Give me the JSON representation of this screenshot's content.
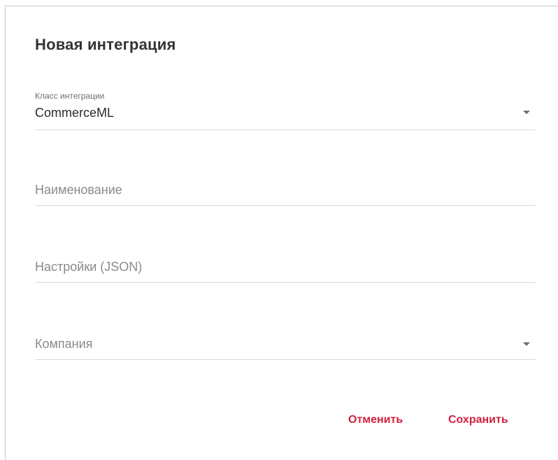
{
  "dialog": {
    "title": "Новая интеграция",
    "fields": {
      "integration_class": {
        "label": "Класс интеграции",
        "value": "CommerceML",
        "icon": "dropdown-arrow-icon"
      },
      "name": {
        "placeholder": "Наименование"
      },
      "settings_json": {
        "placeholder": "Настройки (JSON)"
      },
      "company": {
        "placeholder": "Компания",
        "icon": "dropdown-arrow-icon"
      }
    },
    "actions": {
      "cancel_label": "Отменить",
      "save_label": "Сохранить"
    }
  },
  "colors": {
    "accent": "#d0213f",
    "text": "#2b2b2b",
    "placeholder": "#8a8a8a",
    "divider": "#d9d9d9",
    "background": "#ffffff"
  }
}
